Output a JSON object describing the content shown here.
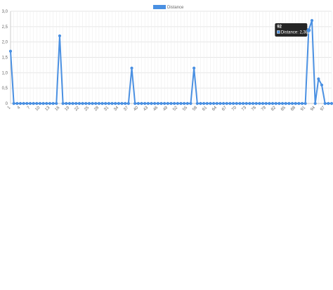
{
  "chart_data": {
    "type": "line",
    "ylim": [
      0,
      3.0
    ],
    "y_ticks": [
      "0",
      "0,5",
      "1,0",
      "1,5",
      "2,0",
      "2,5",
      "3,0"
    ],
    "x_tick_labels": [
      "1",
      "4",
      "7",
      "10",
      "13",
      "16",
      "19",
      "22",
      "25",
      "28",
      "31",
      "34",
      "37",
      "40",
      "43",
      "46",
      "49",
      "52",
      "55",
      "58",
      "61",
      "64",
      "67",
      "70",
      "73",
      "76",
      "79",
      "82",
      "85",
      "88",
      "91",
      "94",
      "97"
    ],
    "x_count": 99,
    "grid": true,
    "legend_position": "top",
    "series": [
      {
        "name": "Distance",
        "color": "#4a90e2",
        "points": [
          {
            "x": 1,
            "y": 1.7
          },
          {
            "x": 2,
            "y": 0
          },
          {
            "x": 15,
            "y": 0
          },
          {
            "x": 16,
            "y": 2.2
          },
          {
            "x": 17,
            "y": 0
          },
          {
            "x": 37,
            "y": 0
          },
          {
            "x": 38,
            "y": 1.15
          },
          {
            "x": 39,
            "y": 0
          },
          {
            "x": 56,
            "y": 0
          },
          {
            "x": 57,
            "y": 1.15
          },
          {
            "x": 58,
            "y": 0
          },
          {
            "x": 99,
            "y": 0
          }
        ],
        "overrides": [
          {
            "x": 92,
            "y": 2.382
          },
          {
            "x": 93,
            "y": 2.7
          },
          {
            "x": 94,
            "y": 0
          },
          {
            "x": 95,
            "y": 0.8
          },
          {
            "x": 96,
            "y": 0.6
          },
          {
            "x": 97,
            "y": 0
          }
        ]
      }
    ],
    "tooltip": {
      "x": 92,
      "title": "92",
      "label": "Distance: 2,382"
    }
  }
}
